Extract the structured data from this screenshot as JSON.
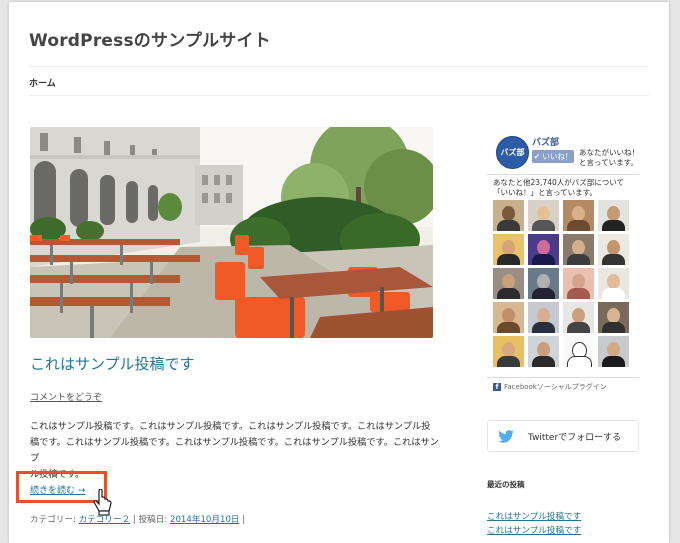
{
  "site": {
    "title": "WordPressのサンプルサイト"
  },
  "nav": {
    "home": "ホーム"
  },
  "post": {
    "title": "これはサンプル投稿です",
    "comment_link": "コメントをどうぞ",
    "body_lines": [
      "これはサンプル投稿です。これはサンプル投稿です。これはサンプル投稿です。これはサンプル投",
      "稿です。これはサンプル投稿です。これはサンプル投稿です。これはサンプル投稿です。これはサンプ",
      "ル投稿です。"
    ],
    "read_more": "続きを読む →",
    "meta": {
      "category_prefix": "カテゴリー:",
      "category": "カテゴリー２",
      "sep1": "|",
      "date_prefix": "投稿日:",
      "date": "2014年10月10日",
      "sep2": "|"
    },
    "highlight_color": "#e8502c"
  },
  "facebook": {
    "page_name": "バズ部",
    "avatar_text": "バズ部",
    "like_button": "✔ いいね！",
    "like_text": "あなたがいいね！と言っています。",
    "count_text": "あなたと他23,740人がバズ部について「いいね！」と言っています。",
    "plugin": "Facebookソーシャルプラグイン",
    "brand_color": "#3b5998"
  },
  "twitter": {
    "label": "Twitterでフォローする",
    "brand_color": "#55acee"
  },
  "recent": {
    "title": "最近の投稿",
    "items": [
      "これはサンプル投稿です",
      "これはサンプル投稿です"
    ]
  }
}
